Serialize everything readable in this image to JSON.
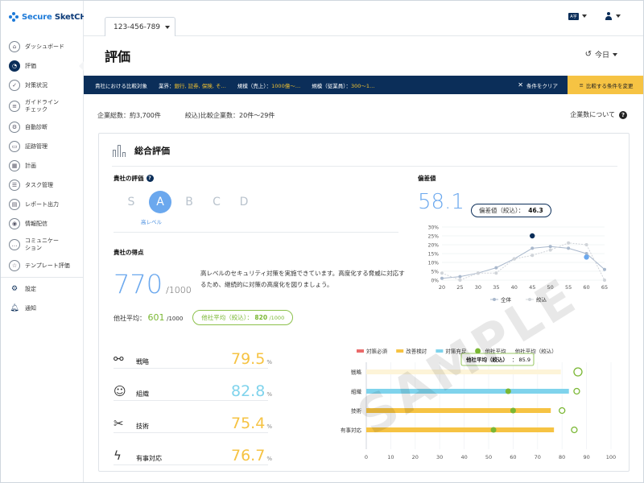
{
  "brand": {
    "part1": "Secure ",
    "part2": "SketCH"
  },
  "sidebar": {
    "items": [
      {
        "label": "ダッシュボード",
        "icon": "home-icon"
      },
      {
        "label": "評価",
        "icon": "pie-icon",
        "active": true
      },
      {
        "label": "対策状況",
        "icon": "check-icon"
      },
      {
        "label": "ガイドライン チェック",
        "icon": "list-check-icon"
      },
      {
        "label": "自動診断",
        "icon": "gear-icon"
      },
      {
        "label": "証跡管理",
        "icon": "folder-icon"
      },
      {
        "label": "計画",
        "icon": "calendar-icon"
      },
      {
        "label": "タスク管理",
        "icon": "task-icon"
      },
      {
        "label": "レポート出力",
        "icon": "report-icon"
      },
      {
        "label": "情報配信",
        "icon": "broadcast-icon"
      },
      {
        "label": "コミュニケー ション",
        "icon": "chat-icon"
      },
      {
        "label": "テンプレート評価",
        "icon": "template-icon"
      }
    ],
    "settings": "設定",
    "notice": "通知"
  },
  "header": {
    "tab_label": "123-456-789",
    "page_title": "評価",
    "today": "今日"
  },
  "filter": {
    "label": "貴社における比較対象",
    "industry_label": "業界：",
    "industry_value": "銀行, 証券, 保険, そ…",
    "sales_label": "規模（売上）：",
    "sales_value": "1000億〜…",
    "staff_label": "規模（従業員）：",
    "staff_value": "300〜1…",
    "clear": "条件をクリア",
    "change": "比較する条件を変更"
  },
  "summary": {
    "total": "企業総数：約3,700件",
    "narrowed": "絞込)比較企業数：20件〜29件",
    "about": "企業数について"
  },
  "card": {
    "title": "総合評価",
    "grade_label": "貴社の評価",
    "grades": [
      "S",
      "A",
      "B",
      "C",
      "D"
    ],
    "selected_grade": "A",
    "grade_sub": "高レベル",
    "score_label": "貴社の得点",
    "score": "770",
    "score_max": "/1000",
    "score_desc": "高レベルのセキュリティ対策を実施できています。高度化する脅威に対応するため、継続的に対策の高度化を図りましょう。",
    "avg_label": "他社平均：",
    "avg_value": "601",
    "avg_max": "/1000",
    "avg_narrow_label": "他社平均（絞込）：",
    "avg_narrow_value": "820",
    "avg_narrow_max": "/1000",
    "dev_label": "偏差値",
    "dev_value": "58.1",
    "dev_narrow_label": "偏差値（絞込）：",
    "dev_narrow_value": "46.3",
    "watermark": "SAMPLE",
    "categories": [
      {
        "name": "戦略",
        "value": "79.5",
        "unit": "%",
        "color": "#f6c343",
        "icon": "sitemap-icon"
      },
      {
        "name": "組織",
        "value": "82.8",
        "unit": "%",
        "color": "#7fd3ec",
        "icon": "users-icon"
      },
      {
        "name": "技術",
        "value": "75.4",
        "unit": "%",
        "color": "#f6c343",
        "icon": "tools-icon"
      },
      {
        "name": "有事対応",
        "value": "76.7",
        "unit": "%",
        "color": "#f6c343",
        "icon": "bolt-icon"
      }
    ]
  },
  "chart_data": [
    {
      "type": "line",
      "x": [
        20,
        25,
        30,
        35,
        40,
        45,
        50,
        55,
        60,
        65
      ],
      "yticks": [
        "0%",
        "5%",
        "10%",
        "15%",
        "20%",
        "25%",
        "30%"
      ],
      "ylim": [
        0,
        30
      ],
      "series": [
        {
          "name": "全体",
          "values": [
            1,
            2,
            4,
            7,
            12,
            18,
            19,
            18,
            15,
            6
          ],
          "color": "#a9b8cc"
        },
        {
          "name": "絞込",
          "values": [
            4,
            0,
            4,
            4,
            12,
            14,
            17,
            21,
            20,
            0
          ],
          "color": "#d0d4d9"
        }
      ],
      "highlight": [
        {
          "x": 45,
          "y": 25,
          "color": "#0b2e59"
        },
        {
          "x": 60,
          "y": 13,
          "color": "#6ba8ee"
        }
      ]
    },
    {
      "type": "bar",
      "orientation": "horizontal",
      "legend": [
        "対策必須",
        "改善検討",
        "対策充足",
        "他社平均",
        "他社平均（絞込）"
      ],
      "legend_colors": [
        "#ea6b6b",
        "#f6c343",
        "#7fd3ec",
        "#7ab733",
        "#ffffff"
      ],
      "categories": [
        "戦略",
        "組織",
        "技術",
        "有事対応"
      ],
      "values": [
        79.5,
        82.8,
        75.4,
        76.7
      ],
      "bar_colors": [
        "#fdf4d8",
        "#7fd3ec",
        "#f6c343",
        "#f6c343"
      ],
      "others_avg": [
        87,
        58,
        60,
        52
      ],
      "others_avg_narrow": [
        86.5,
        86,
        80,
        85
      ],
      "xticks": [
        0,
        10,
        20,
        30,
        40,
        50,
        60,
        70,
        80,
        90,
        100
      ],
      "xlim": [
        0,
        100
      ],
      "tooltip_label": "他社平均（絞込）",
      "tooltip_value": "85.9"
    }
  ]
}
